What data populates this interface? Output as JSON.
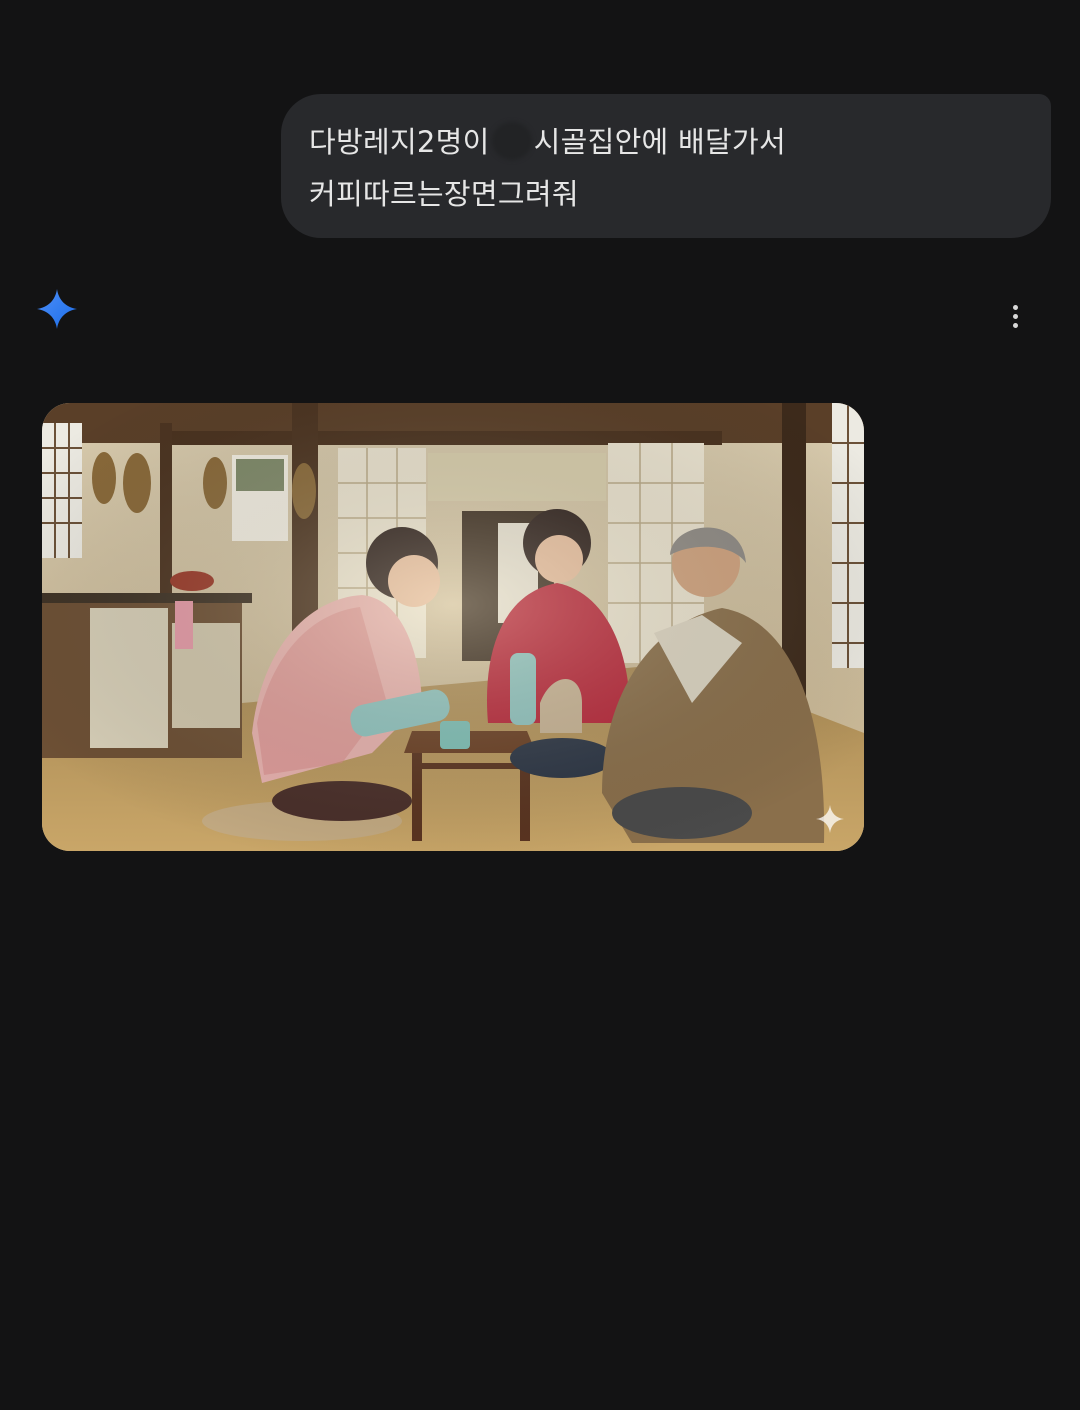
{
  "conversation": {
    "user_message": {
      "text_part1": "다방레지2명이",
      "text_part2": "시골집안에 배달가서 커피따르는장면그려줘"
    },
    "assistant": {
      "logo_icon": "gemini-sparkle-icon",
      "menu_icon": "more-vert-icon",
      "image": {
        "content": "generated-image",
        "watermark_icon": "sparkle-watermark-icon"
      }
    }
  },
  "colors": {
    "background": "#131314",
    "bubble": "#28292c",
    "text": "#e6e6e6",
    "accent": "#4285f4"
  }
}
